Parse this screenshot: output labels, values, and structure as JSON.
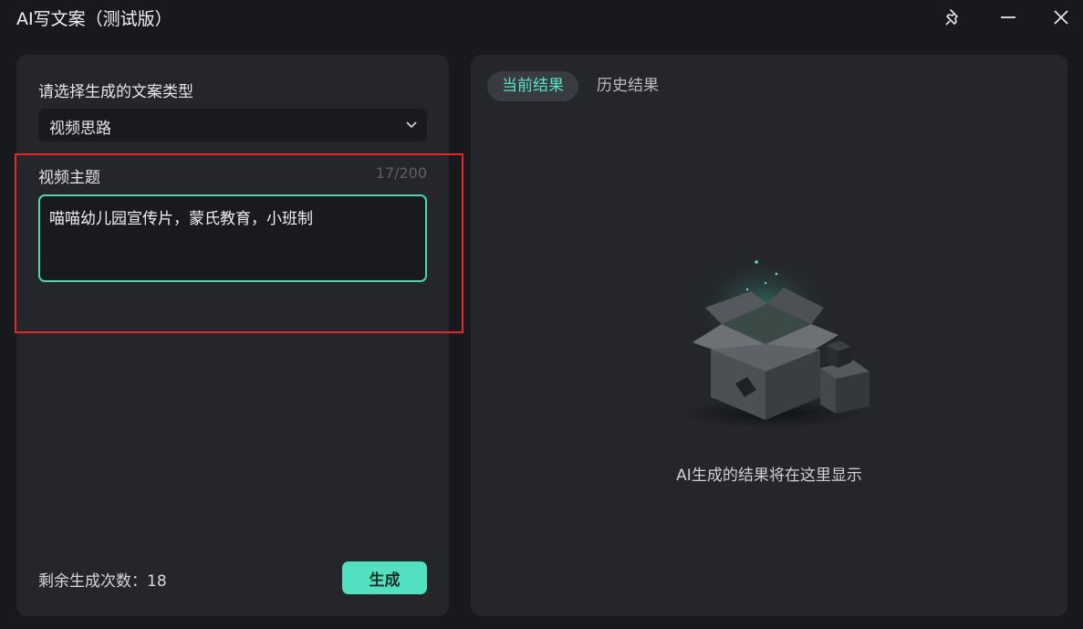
{
  "window": {
    "title": "AI写文案（测试版）",
    "icons": [
      "pin-icon",
      "minimize-icon",
      "close-icon"
    ]
  },
  "left_panel": {
    "type_label": "请选择生成的文案类型",
    "type_selected": "视频思路",
    "topic_label": "视频主题",
    "char_counter": "17/200",
    "topic_value": "喵喵幼儿园宣传片，蒙氏教育，小班制",
    "remaining_label": "剩余生成次数：18",
    "generate_button": "生成"
  },
  "right_panel": {
    "tabs": [
      {
        "label": "当前结果",
        "active": true
      },
      {
        "label": "历史结果",
        "active": false
      }
    ],
    "empty_message": "AI生成的结果将在这里显示",
    "illustration": "empty-box-icon"
  },
  "colors": {
    "accent": "#52e0c0",
    "panel": "#24262a",
    "background": "#18191c",
    "highlight": "#e02a2a"
  }
}
